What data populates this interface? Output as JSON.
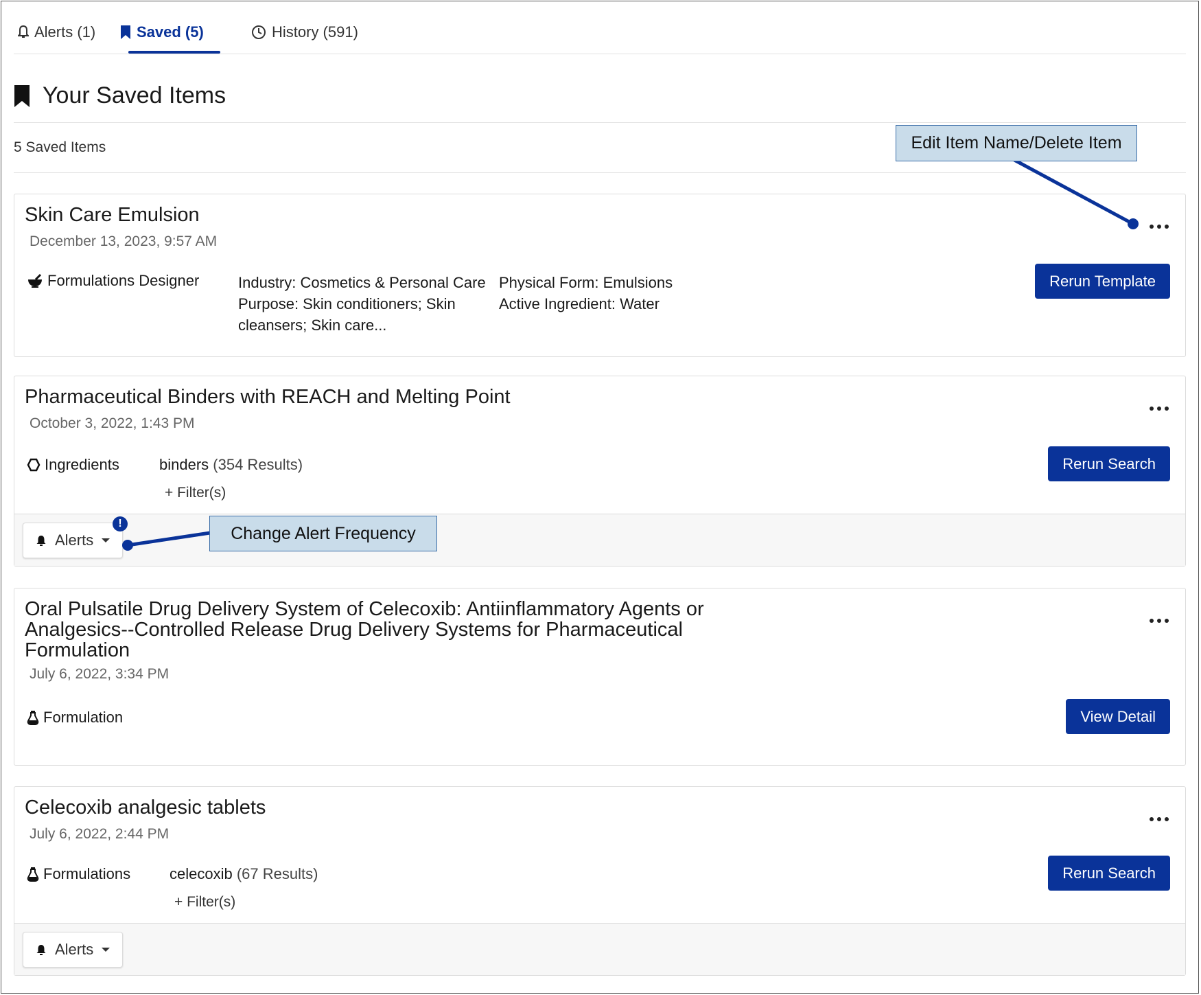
{
  "tabs": [
    {
      "label": "Alerts (1)",
      "icon": "bell-outline-icon"
    },
    {
      "label": "Saved (5)",
      "icon": "bookmark-icon",
      "active": true
    },
    {
      "label": "History (591)",
      "icon": "clock-icon"
    }
  ],
  "page": {
    "title": "Your Saved Items",
    "count": "5 Saved Items"
  },
  "callouts": {
    "edit": "Edit Item Name/Delete Item",
    "alert": "Change Alert Frequency"
  },
  "items": [
    {
      "title": "Skin Care Emulsion",
      "date": "December 13, 2023, 9:57 AM",
      "type": "Formulations Designer",
      "criteria_left": [
        "Industry: Cosmetics & Personal Care",
        "Purpose: Skin conditioners; Skin",
        "cleansers; Skin care..."
      ],
      "criteria_right": [
        "Physical Form: Emulsions",
        "Active Ingredient: Water"
      ],
      "action": "Rerun Template"
    },
    {
      "title": "Pharmaceutical Binders with REACH and Melting Point",
      "date": "October 3, 2022, 1:43 PM",
      "type": "Ingredients",
      "query": "binders",
      "results": "(354 Results)",
      "filters": "+ Filter(s)",
      "action": "Rerun Search",
      "alerts_label": "Alerts",
      "alert_badge": "!"
    },
    {
      "title_lines": [
        "Oral Pulsatile Drug Delivery System of Celecoxib: Antiinflammatory Agents or",
        "Analgesics--Controlled Release Drug Delivery Systems for Pharmaceutical",
        "Formulation"
      ],
      "date": "July 6, 2022, 3:34 PM",
      "type": "Formulation",
      "action": "View Detail"
    },
    {
      "title": "Celecoxib analgesic tablets",
      "date": "July 6, 2022, 2:44 PM",
      "type": "Formulations",
      "query": "celecoxib",
      "results": "(67 Results)",
      "filters": "+ Filter(s)",
      "action": "Rerun Search",
      "alerts_label": "Alerts"
    }
  ],
  "colors": {
    "accent": "#0a3399",
    "callout_bg": "#c9dcea"
  }
}
